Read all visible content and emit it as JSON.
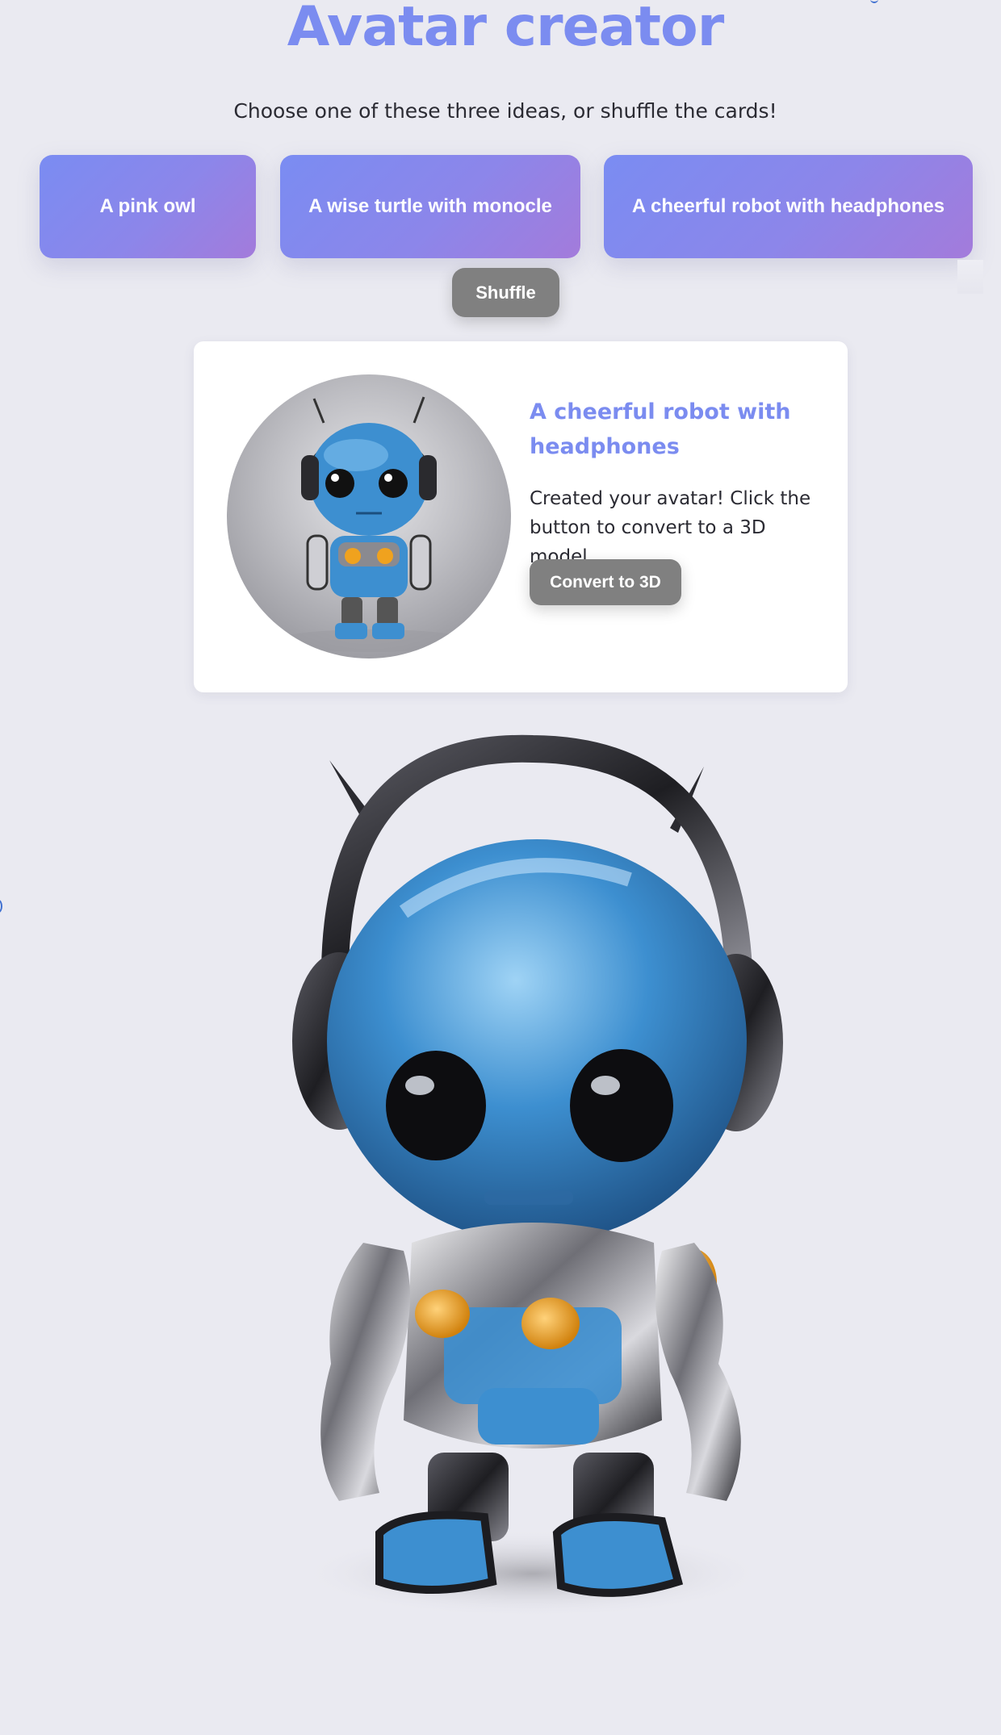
{
  "app": {
    "title": "Avatar creator",
    "subtitle": "Choose one of these three ideas, or shuffle the cards!"
  },
  "ideas": [
    {
      "label": "A pink owl"
    },
    {
      "label": "A wise turtle with monocle"
    },
    {
      "label": "A cheerful robot with headphones"
    }
  ],
  "shuffle_label": "Shuffle",
  "result": {
    "title": "A cheerful robot with headphones",
    "message": "Created your avatar! Click the button to convert to a 3D model.",
    "convert_label": "Convert to 3D"
  },
  "colors": {
    "accent": "#7b8cf0",
    "card_gradient_start": "#7a8cf2",
    "card_gradient_end": "#a37bdb",
    "button_gray": "#808080",
    "background": "#eaeaf1",
    "robot_blue": "#3d8fd0",
    "robot_orange": "#f0a21e"
  },
  "icons": {
    "avatar_image": "robot-avatar-image",
    "model_3d": "robot-3d-model"
  }
}
